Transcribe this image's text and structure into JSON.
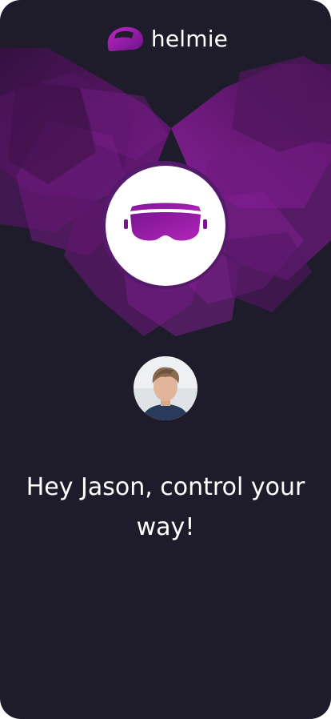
{
  "app": {
    "brand_name": "helmie",
    "logo_icon": "helmet-icon"
  },
  "hero": {
    "icon": "vr-goggles-icon"
  },
  "user": {
    "avatar_icon": "user-avatar"
  },
  "greeting": {
    "text": "Hey Jason, control your way!"
  },
  "colors": {
    "background": "#1e1c2a",
    "accent": "#a41fb0",
    "accent_dark": "#5c1b72",
    "text": "#ffffff"
  }
}
